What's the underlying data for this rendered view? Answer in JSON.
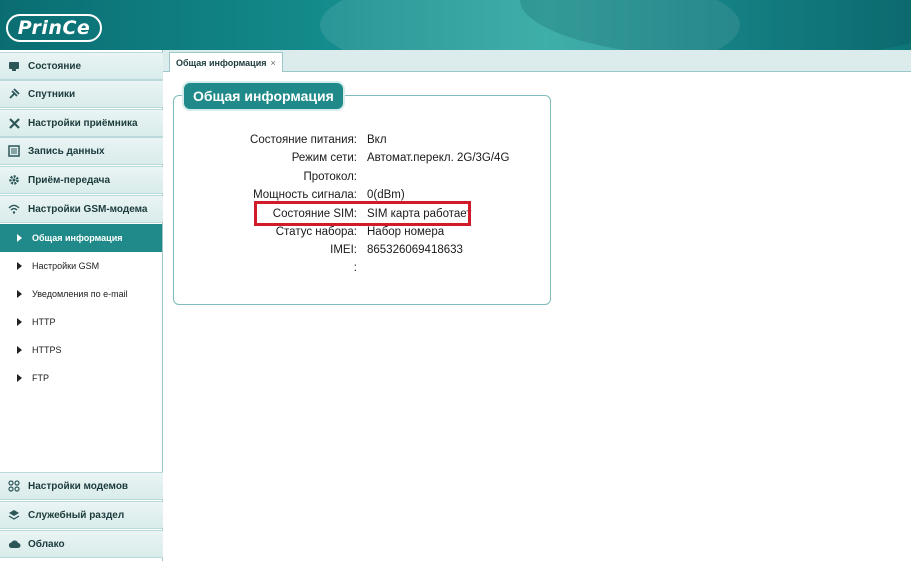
{
  "header": {
    "logo_text": "PrinCe"
  },
  "sidebar": {
    "items": [
      {
        "label": "Состояние",
        "icon": "status-icon"
      },
      {
        "label": "Спутники",
        "icon": "satellite-icon"
      },
      {
        "label": "Настройки приёмника",
        "icon": "tools-icon"
      },
      {
        "label": "Запись данных",
        "icon": "record-icon"
      },
      {
        "label": "Приём-передача",
        "icon": "gear-icon"
      },
      {
        "label": "Настройки GSM-модема",
        "icon": "wifi-icon"
      }
    ],
    "subitems": [
      {
        "label": "Общая информация",
        "active": true
      },
      {
        "label": "Настройки GSM",
        "active": false
      },
      {
        "label": "Уведомления по e-mail",
        "active": false
      },
      {
        "label": "HTTP",
        "active": false
      },
      {
        "label": "HTTPS",
        "active": false
      },
      {
        "label": "FTP",
        "active": false
      }
    ],
    "bottom_items": [
      {
        "label": "Настройки модемов",
        "icon": "modems-icon"
      },
      {
        "label": "Служебный раздел",
        "icon": "layers-icon"
      },
      {
        "label": "Облако",
        "icon": "cloud-icon"
      }
    ]
  },
  "tabs": [
    {
      "label": "Общая информация",
      "close": "×"
    }
  ],
  "panel": {
    "title": "Общая информация",
    "rows": [
      {
        "label": "Состояние питания:",
        "value": "Вкл"
      },
      {
        "label": "Режим сети:",
        "value": "Автомат.перекл. 2G/3G/4G"
      },
      {
        "label": "Протокол:",
        "value": ""
      },
      {
        "label": "Мощность сигнала:",
        "value": "0(dBm)"
      },
      {
        "label": "Состояние SIM:",
        "value": "SIM карта работает"
      },
      {
        "label": "Статус набора:",
        "value": "Набор номера"
      },
      {
        "label": "IMEI:",
        "value": "865326069418633"
      },
      {
        "label": ":",
        "value": ""
      }
    ]
  },
  "colors": {
    "accent": "#1f8a89",
    "highlight": "#d11a2a"
  }
}
